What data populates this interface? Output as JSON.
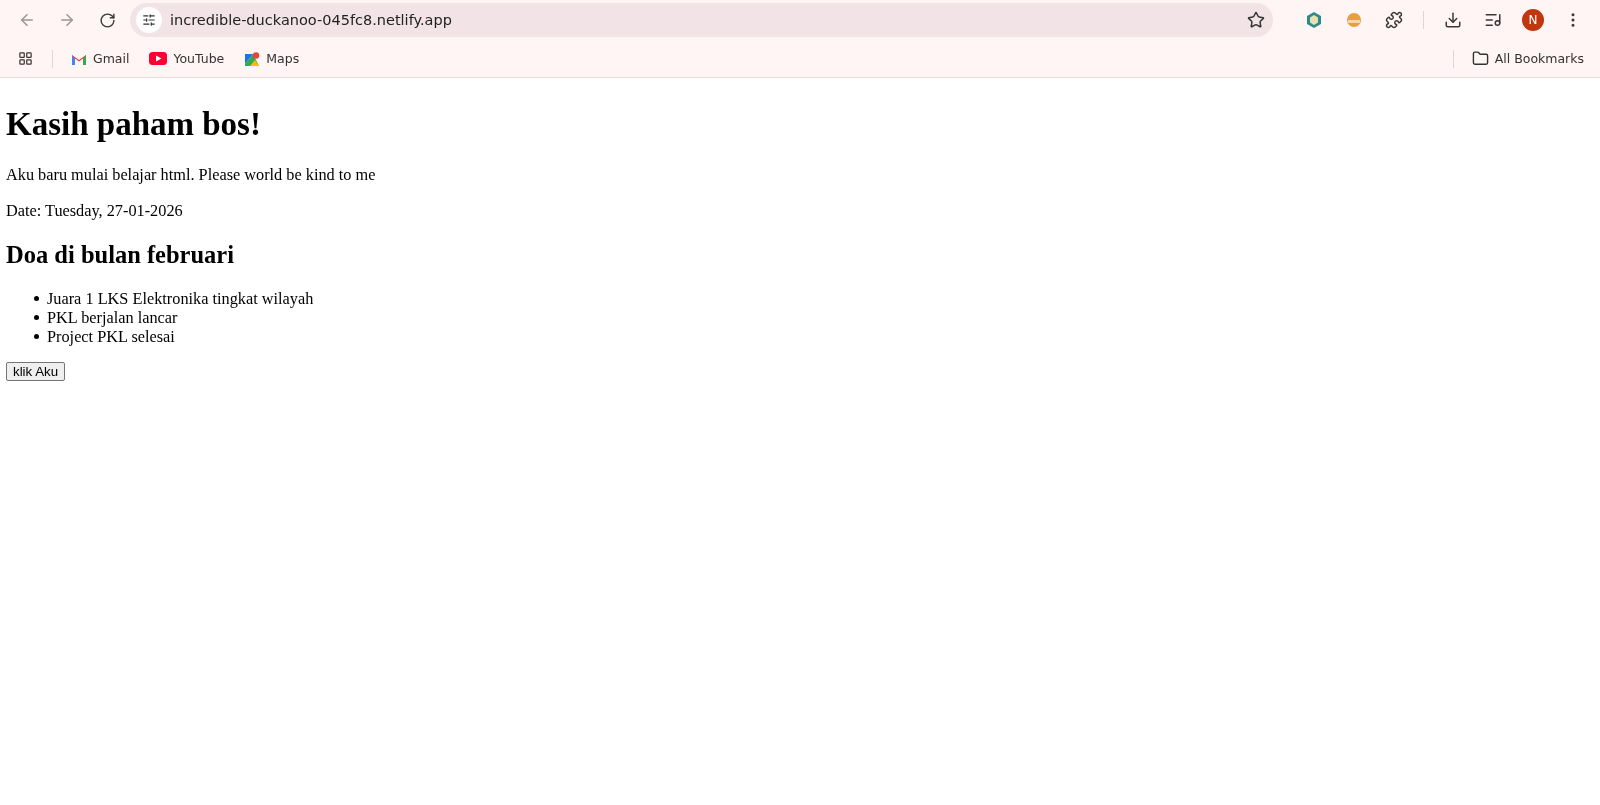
{
  "browser": {
    "url": "incredible-duckanoo-045fc8.netlify.app",
    "profile_initial": "N",
    "bookmarks": [
      {
        "label": "Gmail",
        "kind": "gmail"
      },
      {
        "label": "YouTube",
        "kind": "youtube"
      },
      {
        "label": "Maps",
        "kind": "maps"
      }
    ],
    "all_bookmarks": "All Bookmarks"
  },
  "page": {
    "heading": "Kasih paham bos!",
    "paragraphs": [
      "Aku baru mulai belajar html. Please world be kind to me",
      "Date: Tuesday, 27-01-2026"
    ],
    "subheading": "Doa di bulan februari",
    "list": [
      "Juara 1 LKS Elektronika tingkat wilayah",
      "PKL berjalan lancar",
      "Project PKL selesai"
    ],
    "button": "klik Aku"
  }
}
